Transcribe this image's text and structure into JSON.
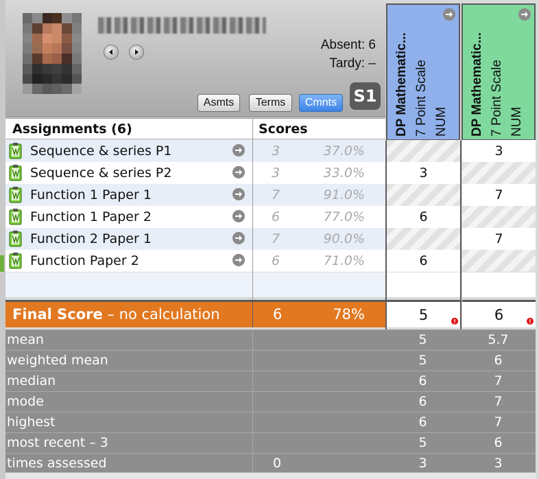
{
  "header": {
    "absent": "Absent: 6",
    "tardy": "Tardy: –",
    "tabs": [
      {
        "label": "Asmts"
      },
      {
        "label": "Terms"
      },
      {
        "label": "Cmnts",
        "active": true
      }
    ],
    "term": "S1"
  },
  "columns": [
    {
      "title": "DP Mathematic...",
      "scale": "7 Point Scale",
      "type": "NUM",
      "color": "#8fb0ea"
    },
    {
      "title": "DP Mathematic...",
      "scale": "7 Point Scale",
      "type": "NUM",
      "color": "#7fd99d"
    }
  ],
  "assignments": {
    "header_label": "Assignments (6)",
    "scores_label": "Scores",
    "rows": [
      {
        "name": "Sequence & series P1",
        "score": "3",
        "pct": "37.0%",
        "c1": "",
        "c2": "3"
      },
      {
        "name": "Sequence & series P2",
        "score": "3",
        "pct": "33.0%",
        "c1": "3",
        "c2": ""
      },
      {
        "name": "Function 1 Paper 1",
        "score": "7",
        "pct": "91.0%",
        "c1": "",
        "c2": "7"
      },
      {
        "name": "Function 1 Paper 2",
        "score": "6",
        "pct": "77.0%",
        "c1": "6",
        "c2": ""
      },
      {
        "name": "Function 2 Paper 1",
        "score": "7",
        "pct": "90.0%",
        "c1": "",
        "c2": "7"
      },
      {
        "name": "Function Paper 2",
        "score": "6",
        "pct": "71.0%",
        "c1": "6",
        "c2": ""
      }
    ]
  },
  "final": {
    "label_bold": "Final Score",
    "label_rest": " – no calculation",
    "score": "6",
    "pct": "78%",
    "c1": "5",
    "c2": "6"
  },
  "stats": [
    {
      "label": "mean",
      "v0": "",
      "c1": "5",
      "c2": "5.7"
    },
    {
      "label": "weighted mean",
      "v0": "",
      "c1": "5",
      "c2": "6"
    },
    {
      "label": "median",
      "v0": "",
      "c1": "6",
      "c2": "7"
    },
    {
      "label": "mode",
      "v0": "",
      "c1": "6",
      "c2": "7"
    },
    {
      "label": "highest",
      "v0": "",
      "c1": "6",
      "c2": "7"
    },
    {
      "label": "most recent – 3",
      "v0": "",
      "c1": "5",
      "c2": "6"
    },
    {
      "label": "times assessed",
      "v0": "0",
      "c1": "3",
      "c2": "3"
    }
  ],
  "colors": {
    "accent_orange": "#e27820",
    "tab_active": "#3d84e8",
    "icon_green": "#6fbf2a"
  }
}
